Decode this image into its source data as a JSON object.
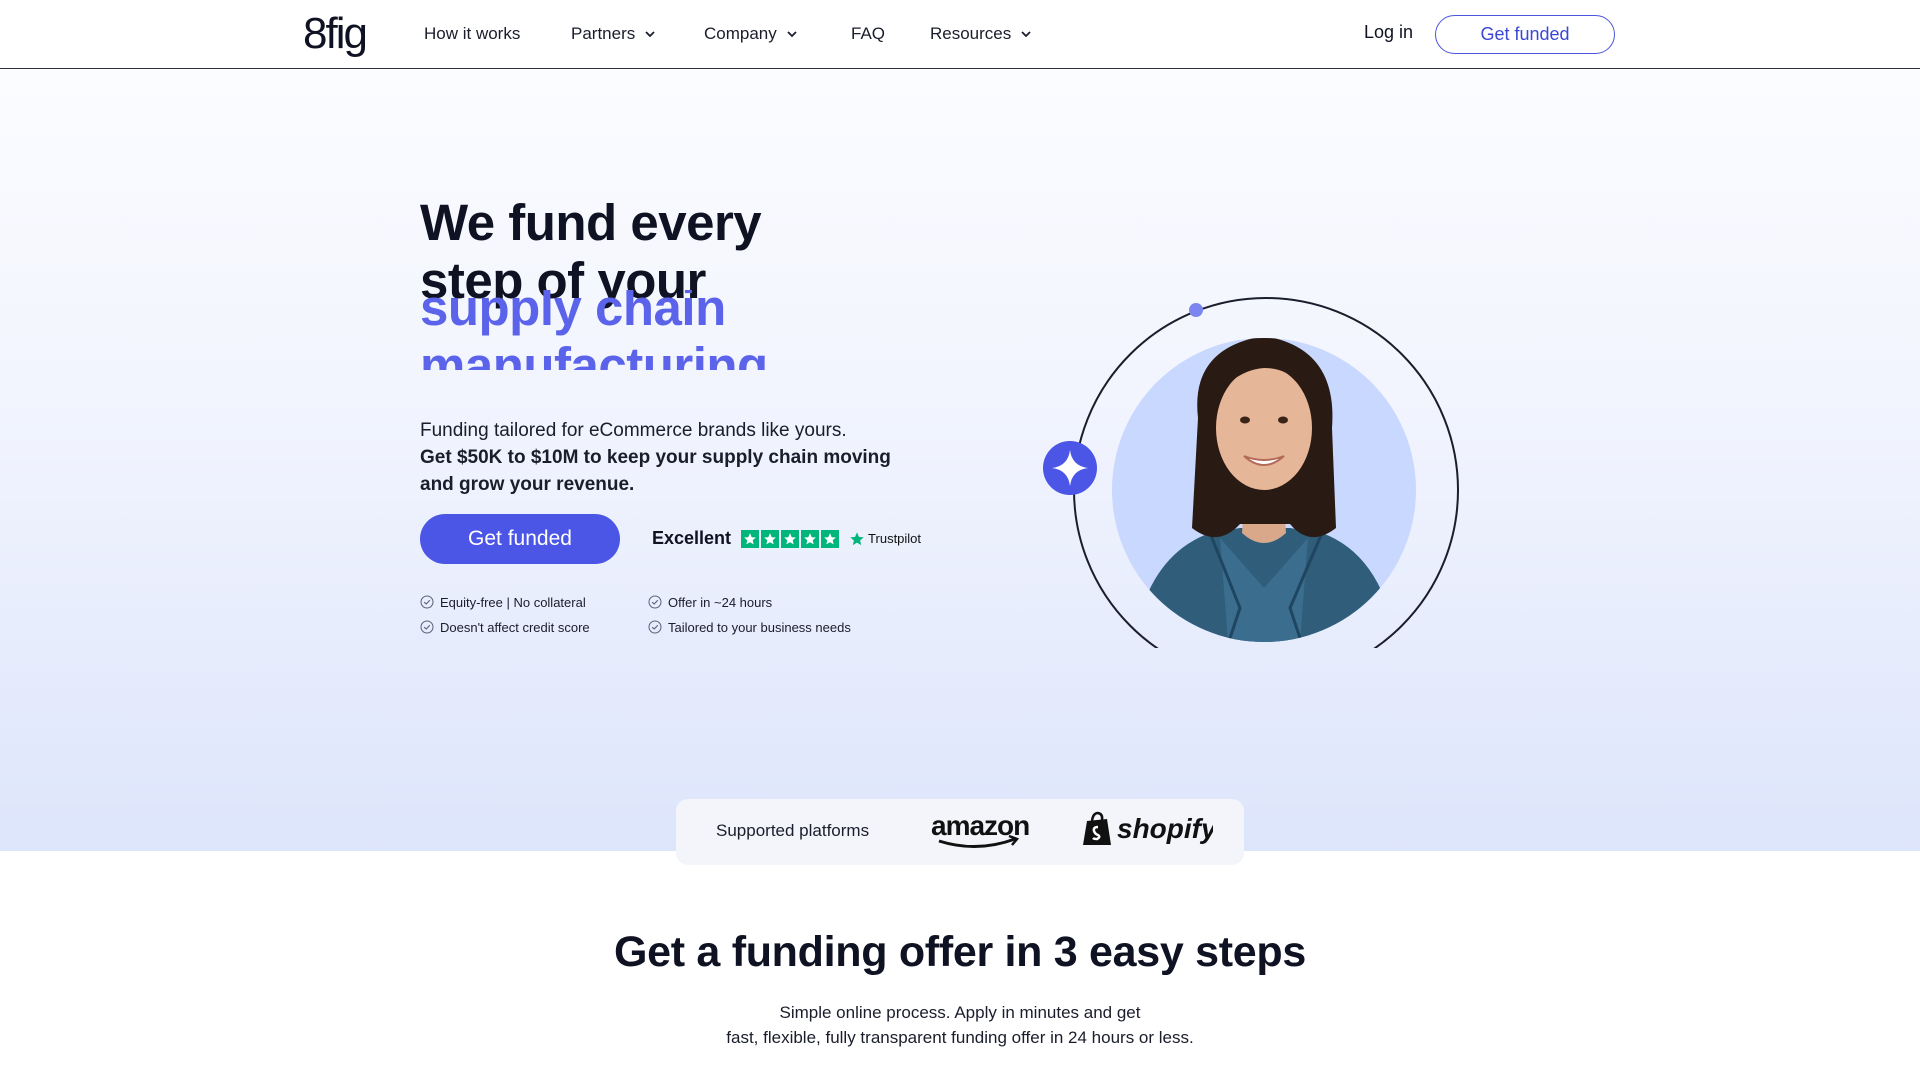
{
  "nav": {
    "logo": "8fig",
    "items": [
      {
        "label": "How it works",
        "has_dropdown": false
      },
      {
        "label": "Partners",
        "has_dropdown": true
      },
      {
        "label": "Company",
        "has_dropdown": true
      },
      {
        "label": "FAQ",
        "has_dropdown": false
      },
      {
        "label": "Resources",
        "has_dropdown": true
      }
    ],
    "login_label": "Log in",
    "cta_label": "Get funded"
  },
  "hero": {
    "headline_line1": "We fund every",
    "headline_line2": "step of your",
    "rotating_words": [
      "supply chain",
      "manufacturing"
    ],
    "sub_line1": "Funding tailored for eCommerce brands like yours.",
    "sub_bold": "Get $50K to $10M to keep your supply chain moving and grow your revenue.",
    "cta_label": "Get funded",
    "trustpilot": {
      "rating_label": "Excellent",
      "brand": "Trustpilot",
      "stars": 5,
      "star_color": "#00b67a"
    },
    "checks": [
      "Equity-free | No collateral",
      "Offer in ~24 hours",
      "Doesn't affect credit score",
      "Tailored to your business needs"
    ]
  },
  "platforms": {
    "label": "Supported platforms",
    "logos": [
      "amazon",
      "shopify"
    ]
  },
  "steps": {
    "title": "Get a funding offer in 3 easy steps",
    "sub_line1": "Simple online process. Apply in minutes and get",
    "sub_line2": "fast, flexible, fully transparent funding offer in 24 hours or less."
  },
  "colors": {
    "accent": "#4b55e6",
    "accent_text": "#3c47d6",
    "rotating_text": "#5a63ea",
    "dark": "#0f1222"
  }
}
